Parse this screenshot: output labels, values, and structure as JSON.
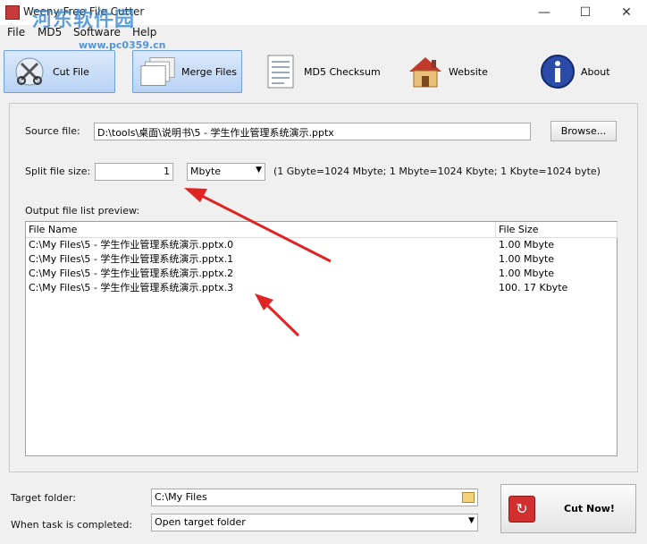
{
  "window": {
    "title": "Weeny Free File Cutter"
  },
  "watermark": {
    "text": "河东软件园",
    "url": "www.pc0359.cn"
  },
  "menu": [
    "File",
    "MD5",
    "Software",
    "Help"
  ],
  "toolbar": {
    "cut": "Cut File",
    "merge": "Merge Files",
    "md5": "MD5 Checksum",
    "website": "Website",
    "about": "About"
  },
  "source": {
    "label": "Source file:",
    "value": "D:\\tools\\桌面\\说明书\\5 - 学生作业管理系统演示.pptx",
    "browse": "Browse..."
  },
  "split": {
    "label": "Split file size:",
    "value": "1",
    "unit": "Mbyte",
    "note": "(1 Gbyte=1024 Mbyte; 1 Mbyte=1024 Kbyte; 1 Kbyte=1024 byte)"
  },
  "preview": {
    "label": "Output file list preview:",
    "columns": [
      "File Name",
      "File Size"
    ],
    "rows": [
      {
        "name": "C:\\My Files\\5 - 学生作业管理系统演示.pptx.0",
        "size": "1.00 Mbyte"
      },
      {
        "name": "C:\\My Files\\5 - 学生作业管理系统演示.pptx.1",
        "size": "1.00 Mbyte"
      },
      {
        "name": "C:\\My Files\\5 - 学生作业管理系统演示.pptx.2",
        "size": "1.00 Mbyte"
      },
      {
        "name": "C:\\My Files\\5 - 学生作业管理系统演示.pptx.3",
        "size": "100. 17 Kbyte"
      }
    ]
  },
  "target": {
    "label": "Target folder:",
    "value": "C:\\My Files"
  },
  "completion": {
    "label": "When task is completed:",
    "value": "Open target folder"
  },
  "cut_now": "Cut Now!"
}
